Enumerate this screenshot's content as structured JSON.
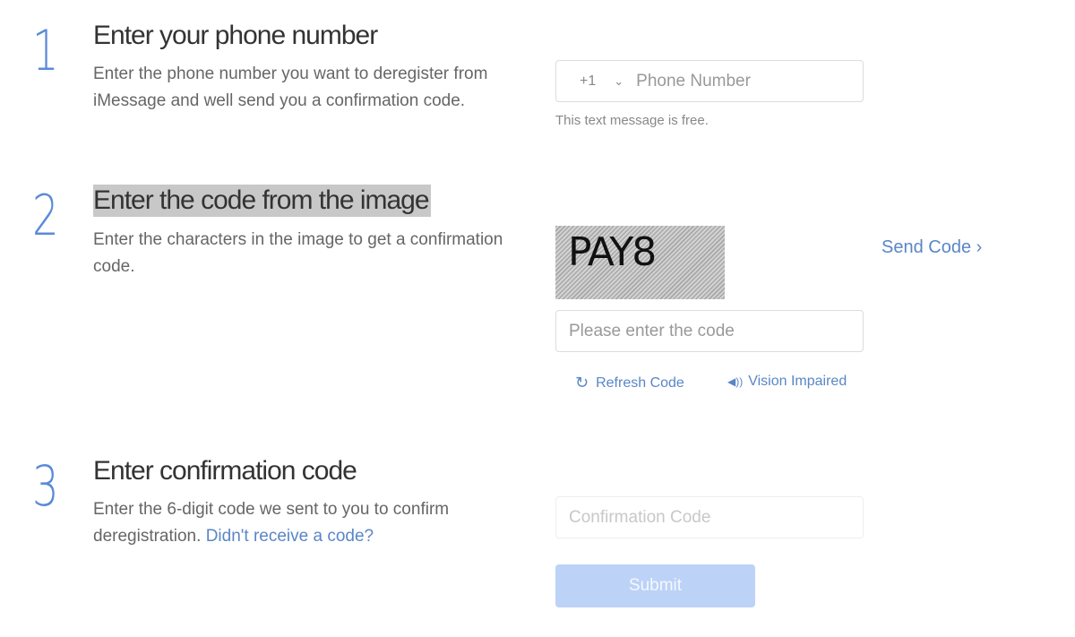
{
  "steps": [
    {
      "number": "1",
      "title": "Enter your phone number",
      "description": "Enter the phone number you want to deregister from iMessage and well send you a confirmation code."
    },
    {
      "number": "2",
      "title": "Enter the code from the image",
      "description": "Enter the characters in the image to get a confirmation code."
    },
    {
      "number": "3",
      "title": "Enter confirmation code",
      "description": "Enter the 6-digit code we sent to you to confirm deregistration.",
      "link": "Didn't receive a code?"
    }
  ],
  "phone": {
    "country_code": "+1",
    "chevron": "⌄",
    "placeholder": "Phone Number",
    "note": "This text message is free."
  },
  "captcha": {
    "text": "PAY8",
    "input_placeholder": "Please enter the code",
    "send_code_label": "Send Code ›",
    "refresh_icon": "↻",
    "refresh_label": "Refresh Code",
    "audio_icon": "◀))",
    "audio_label": "Vision Impaired"
  },
  "confirmation": {
    "placeholder": "Confirmation Code",
    "submit_label": "Submit"
  },
  "colors": {
    "accent": "#5a86c6",
    "step_number": "#5b8ad8",
    "submit_disabled": "#bcd2f7"
  }
}
